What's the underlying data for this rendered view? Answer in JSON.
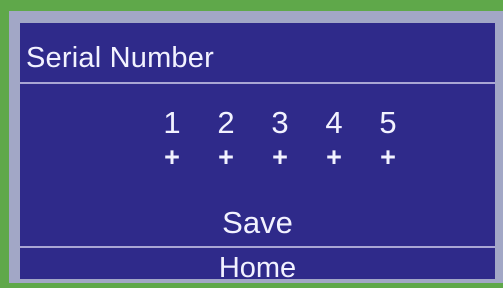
{
  "screen": {
    "title": "Serial Number",
    "digits": [
      {
        "label": "1",
        "increment": "+"
      },
      {
        "label": "2",
        "increment": "+"
      },
      {
        "label": "3",
        "increment": "+"
      },
      {
        "label": "4",
        "increment": "+"
      },
      {
        "label": "5",
        "increment": "+"
      }
    ],
    "save_label": "Save",
    "home_label": "Home"
  },
  "colors": {
    "bezel": "#5fa84a",
    "frame": "#a2a7c6",
    "screen_background": "#2f2a8a",
    "text": "#f2f2ff",
    "divider": "#a9a6d4"
  }
}
